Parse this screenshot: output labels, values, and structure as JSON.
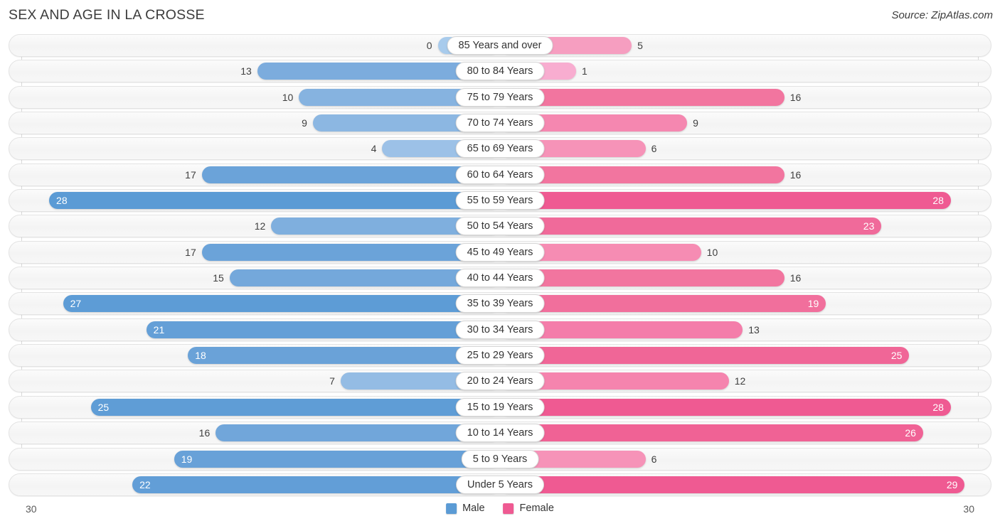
{
  "header": {
    "title": "SEX AND AGE IN LA CROSSE",
    "source": "Source: ZipAtlas.com"
  },
  "legend": {
    "male_label": "Male",
    "female_label": "Female",
    "male_color": "#5b9bd5",
    "female_color": "#ef5a92"
  },
  "axis": {
    "left_tick": "30",
    "right_tick": "30",
    "max": 30
  },
  "chart_data": {
    "type": "bar",
    "subtype": "population-pyramid",
    "title": "SEX AND AGE IN LA CROSSE",
    "xlabel": "",
    "ylabel": "",
    "xlim": [
      30,
      30
    ],
    "grid": false,
    "legend_position": "bottom-center",
    "categories": [
      "85 Years and over",
      "80 to 84 Years",
      "75 to 79 Years",
      "70 to 74 Years",
      "65 to 69 Years",
      "60 to 64 Years",
      "55 to 59 Years",
      "50 to 54 Years",
      "45 to 49 Years",
      "40 to 44 Years",
      "35 to 39 Years",
      "30 to 34 Years",
      "25 to 29 Years",
      "20 to 24 Years",
      "15 to 19 Years",
      "10 to 14 Years",
      "5 to 9 Years",
      "Under 5 Years"
    ],
    "series": [
      {
        "name": "Male",
        "values": [
          0,
          13,
          10,
          9,
          4,
          17,
          28,
          12,
          17,
          15,
          27,
          21,
          18,
          7,
          25,
          16,
          19,
          22
        ]
      },
      {
        "name": "Female",
        "values": [
          5,
          1,
          16,
          9,
          6,
          16,
          28,
          23,
          10,
          16,
          19,
          13,
          25,
          12,
          28,
          26,
          6,
          29
        ]
      }
    ]
  },
  "rows": [
    {
      "label": "85 Years and over",
      "male": 0,
      "female": 5,
      "male_text": "0",
      "female_text": "5",
      "male_inside": false,
      "female_inside": false,
      "male_color": "#a8cbec",
      "female_color": "#f69ec0"
    },
    {
      "label": "80 to 84 Years",
      "male": 13,
      "female": 1,
      "male_text": "13",
      "female_text": "1",
      "male_inside": false,
      "female_inside": false,
      "male_color": "#7cacdd",
      "female_color": "#f8add0"
    },
    {
      "label": "75 to 79 Years",
      "male": 10,
      "female": 16,
      "male_text": "10",
      "female_text": "16",
      "male_inside": false,
      "female_inside": false,
      "male_color": "#86b3e0",
      "female_color": "#f2759f"
    },
    {
      "label": "70 to 74 Years",
      "male": 9,
      "female": 9,
      "male_text": "9",
      "female_text": "9",
      "male_inside": false,
      "female_inside": false,
      "male_color": "#8cb7e2",
      "female_color": "#f587b0"
    },
    {
      "label": "65 to 69 Years",
      "male": 4,
      "female": 6,
      "male_text": "4",
      "female_text": "6",
      "male_inside": false,
      "female_inside": false,
      "male_color": "#9cc1e7",
      "female_color": "#f693b8"
    },
    {
      "label": "60 to 64 Years",
      "male": 17,
      "female": 16,
      "male_text": "17",
      "female_text": "16",
      "male_inside": false,
      "female_inside": false,
      "male_color": "#6ba3d9",
      "female_color": "#f2759f"
    },
    {
      "label": "55 to 59 Years",
      "male": 28,
      "female": 28,
      "male_text": "28",
      "female_text": "28",
      "male_inside": true,
      "female_inside": true,
      "male_color": "#5b9bd5",
      "female_color": "#ef5a92"
    },
    {
      "label": "50 to 54 Years",
      "male": 12,
      "female": 23,
      "male_text": "12",
      "female_text": "23",
      "male_inside": false,
      "female_inside": true,
      "male_color": "#7fafde",
      "female_color": "#f06a9a"
    },
    {
      "label": "45 to 49 Years",
      "male": 17,
      "female": 10,
      "male_text": "17",
      "female_text": "10",
      "male_inside": false,
      "female_inside": false,
      "male_color": "#6ba3d9",
      "female_color": "#f68cb3"
    },
    {
      "label": "40 to 44 Years",
      "male": 15,
      "female": 16,
      "male_text": "15",
      "female_text": "16",
      "male_inside": false,
      "female_inside": false,
      "male_color": "#74a8db",
      "female_color": "#f2759f"
    },
    {
      "label": "35 to 39 Years",
      "male": 27,
      "female": 19,
      "male_text": "27",
      "female_text": "19",
      "male_inside": true,
      "female_inside": true,
      "male_color": "#5d9cd6",
      "female_color": "#f16f9c"
    },
    {
      "label": "30 to 34 Years",
      "male": 21,
      "female": 13,
      "male_text": "21",
      "female_text": "13",
      "male_inside": true,
      "female_inside": false,
      "male_color": "#649fd7",
      "female_color": "#f47daa"
    },
    {
      "label": "25 to 29 Years",
      "male": 18,
      "female": 25,
      "male_text": "18",
      "female_text": "25",
      "male_inside": true,
      "female_inside": true,
      "male_color": "#6aa2d8",
      "female_color": "#f06697"
    },
    {
      "label": "20 to 24 Years",
      "male": 7,
      "female": 12,
      "male_text": "7",
      "female_text": "12",
      "male_inside": false,
      "female_inside": false,
      "male_color": "#94bce4",
      "female_color": "#f584ae"
    },
    {
      "label": "15 to 19 Years",
      "male": 25,
      "female": 28,
      "male_text": "25",
      "female_text": "28",
      "male_inside": true,
      "female_inside": true,
      "male_color": "#5f9dd6",
      "female_color": "#ef5a92"
    },
    {
      "label": "10 to 14 Years",
      "male": 16,
      "female": 26,
      "male_text": "16",
      "female_text": "26",
      "male_inside": false,
      "female_inside": true,
      "male_color": "#71a6da",
      "female_color": "#f06295"
    },
    {
      "label": "5 to 9 Years",
      "male": 19,
      "female": 6,
      "male_text": "19",
      "female_text": "6",
      "male_inside": true,
      "female_inside": false,
      "male_color": "#68a1d8",
      "female_color": "#f693b8"
    },
    {
      "label": "Under 5 Years",
      "male": 22,
      "female": 29,
      "male_text": "22",
      "female_text": "29",
      "male_inside": true,
      "female_inside": true,
      "male_color": "#629ed7",
      "female_color": "#ef5a92"
    }
  ]
}
